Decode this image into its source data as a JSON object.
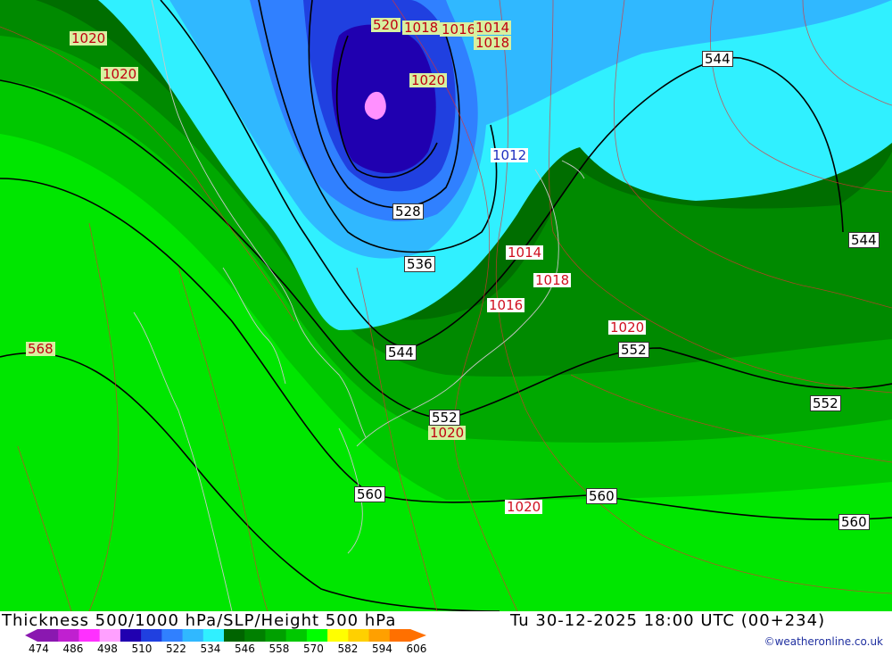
{
  "caption": {
    "title": "Thickness 500/1000 hPa/SLP/Height 500 hPa",
    "datetime": "Tu 30-12-2025 18:00 UTC (00+234)",
    "credit": "©weatheronline.co.uk"
  },
  "legend": {
    "ticks": [
      "474",
      "486",
      "498",
      "510",
      "522",
      "534",
      "546",
      "558",
      "570",
      "582",
      "594",
      "606"
    ],
    "colors": [
      "#8a18b0",
      "#c020d0",
      "#ff30ff",
      "#ffa0ff",
      "#2000b0",
      "#2040e0",
      "#3080ff",
      "#30b8ff",
      "#30f0ff",
      "#006400",
      "#008000",
      "#00a000",
      "#00c800",
      "#00ff00",
      "#ffff00",
      "#ffd000",
      "#ffa000",
      "#ff7000"
    ]
  },
  "labels": {
    "height": [
      "520",
      "528",
      "536",
      "544",
      "544",
      "544",
      "552",
      "552",
      "552",
      "560",
      "560",
      "560",
      "568"
    ],
    "pressure": [
      "1020",
      "1020",
      "1020",
      "1018",
      "1016",
      "1014",
      "1018",
      "1012",
      "1014",
      "1018",
      "1016",
      "1020",
      "1020",
      "1020"
    ]
  }
}
